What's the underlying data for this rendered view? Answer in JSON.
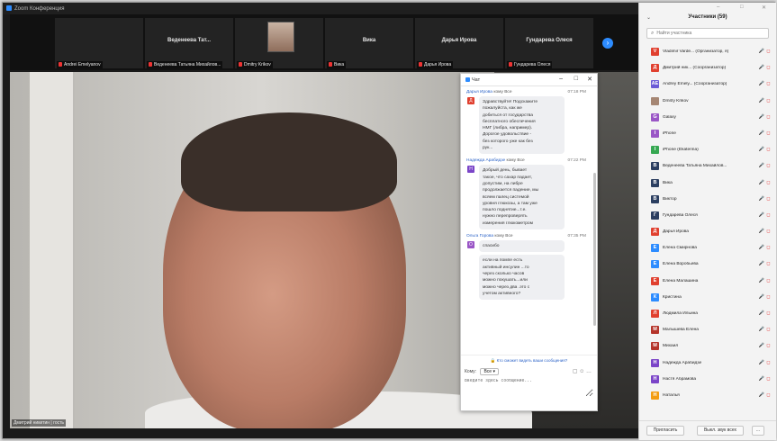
{
  "window": {
    "title": "Zoom Конференция"
  },
  "gallery": {
    "tiles": [
      {
        "name": "",
        "footer": "Andrei Emelyanov"
      },
      {
        "name": "Веденеева Тат...",
        "footer": "Веденеева Татьяна Михайлов..."
      },
      {
        "name": "",
        "footer": "Dmitry Krikov"
      },
      {
        "name": "Вика",
        "footer": "Вика"
      },
      {
        "name": "Дарья Ирова",
        "footer": "Дарья Ирова"
      },
      {
        "name": "Гундарева Олеся",
        "footer": "Гундарева Олеся"
      }
    ],
    "next_icon": "chevron-right-icon"
  },
  "video": {
    "caption": "Дмитрий никитин | гость"
  },
  "chat": {
    "title": "Чат",
    "messages": [
      {
        "sender": "Дарья Ирова",
        "to": "кому Все",
        "time": "07:18 PM",
        "avatar": "Д",
        "color": "#e0402f",
        "bubbles": [
          "Здравствуйте! Подскажите\nпожалуйста, как же\nдобиться от государства\nбесплатного обеспечения\nНМГ (либра, например).\nДорогое удовольствие -\nбез которого уже как без\nрук..."
        ]
      },
      {
        "sender": "Надежда Арабидзе",
        "to": "кому Все",
        "time": "07:22 PM",
        "avatar": "Н",
        "color": "#7b45c8",
        "bubbles": [
          "Добрый день, бывает\nтакое, что сахар падает,\nдопустим, на либре\nпродолжается падение, мы\nвсяем палец системой\nуровня глюкозы, а там уже\nпошло поднятие...т.е.\nнужно перепроверять\nизмерения глюкометром"
        ]
      },
      {
        "sender": "Ольга Горова",
        "to": "кому Все",
        "time": "07:35 PM",
        "avatar": "О",
        "color": "#9a56c6",
        "bubbles": [
          "спасибо",
          "если на помпе есть\nактивный инсулин ...то\nчерез сколько часов\nможно покушать...или\nможно через два .это с\nучетом активного?"
        ]
      }
    ],
    "who_can_see": "Кто сможет видеть ваши сообщения?",
    "to_label": "Кому:",
    "to_value": "Все",
    "input_placeholder": "Введите здесь сообщение..."
  },
  "participants": {
    "title": "Участники (59)",
    "search_placeholder": "Найти участника",
    "list": [
      {
        "name": "Vladimir Varde... (Организатор, я)",
        "av": "V",
        "color": "#e0402f",
        "icons": "🎤 ◻"
      },
      {
        "name": "Дмитрий ник... (Соорганизатор)",
        "av": "Д",
        "color": "#e0402f",
        "icons": "🎤 ◻"
      },
      {
        "name": "Andrey Emely... (Соорганизатор)",
        "av": "AE",
        "color": "#6b5bd6",
        "icons": "🎤 ◻"
      },
      {
        "name": "Dmitry Krikov",
        "av": "",
        "color": "#a58673",
        "icons": "🎤 ◻"
      },
      {
        "name": "Galaxy",
        "av": "G",
        "color": "#9a56c6",
        "icons": "🎤 ◻"
      },
      {
        "name": "iPhone",
        "av": "I",
        "color": "#9a56c6",
        "icons": "🎤 ◻"
      },
      {
        "name": "iPhone (Ekaterina)",
        "av": "I",
        "color": "#36a852",
        "icons": "🎤 ◻"
      },
      {
        "name": "Веденеева Татьяна Михайлов...",
        "av": "В",
        "color": "#2b3e60",
        "icons": "🎤 ◻"
      },
      {
        "name": "Вика",
        "av": "В",
        "color": "#2b3e60",
        "icons": "🎤 ◻"
      },
      {
        "name": "Виктор",
        "av": "В",
        "color": "#2b3e60",
        "icons": "🎤 ◻"
      },
      {
        "name": "Гундарева Олеся",
        "av": "Г",
        "color": "#2b3e60",
        "icons": "🎤 ◻"
      },
      {
        "name": "Дарья Ирова",
        "av": "Д",
        "color": "#e0402f",
        "icons": "🎤 ◻"
      },
      {
        "name": "Елена Смирнова",
        "av": "Е",
        "color": "#2d8cff",
        "icons": "🎤 ◻"
      },
      {
        "name": "Елена Воробьева",
        "av": "Е",
        "color": "#2d8cff",
        "icons": "🎤 ◻"
      },
      {
        "name": "Елена Малашина",
        "av": "Е",
        "color": "#e0402f",
        "icons": "🎤 ◻"
      },
      {
        "name": "Кристина",
        "av": "К",
        "color": "#2d8cff",
        "icons": "🎤 ◻"
      },
      {
        "name": "Людмила Ильина",
        "av": "Л",
        "color": "#e0402f",
        "icons": "🎤 ◻"
      },
      {
        "name": "Малышева Елена",
        "av": "М",
        "color": "#b4342a",
        "icons": "🎤 ◻"
      },
      {
        "name": "Михаил",
        "av": "М",
        "color": "#b4342a",
        "icons": "🎤 ◻"
      },
      {
        "name": "Надежда Арабидзе",
        "av": "Н",
        "color": "#7b45c8",
        "icons": "🎤 ◻"
      },
      {
        "name": "Настя Абрамова",
        "av": "Н",
        "color": "#7b45c8",
        "icons": "🎤 ◻"
      },
      {
        "name": "Наталья",
        "av": "Н",
        "color": "#f39c12",
        "icons": "🎤 ◻"
      }
    ],
    "invite_label": "Пригласить",
    "mute_all_label": "Выкл. звук всех",
    "more_label": "..."
  }
}
